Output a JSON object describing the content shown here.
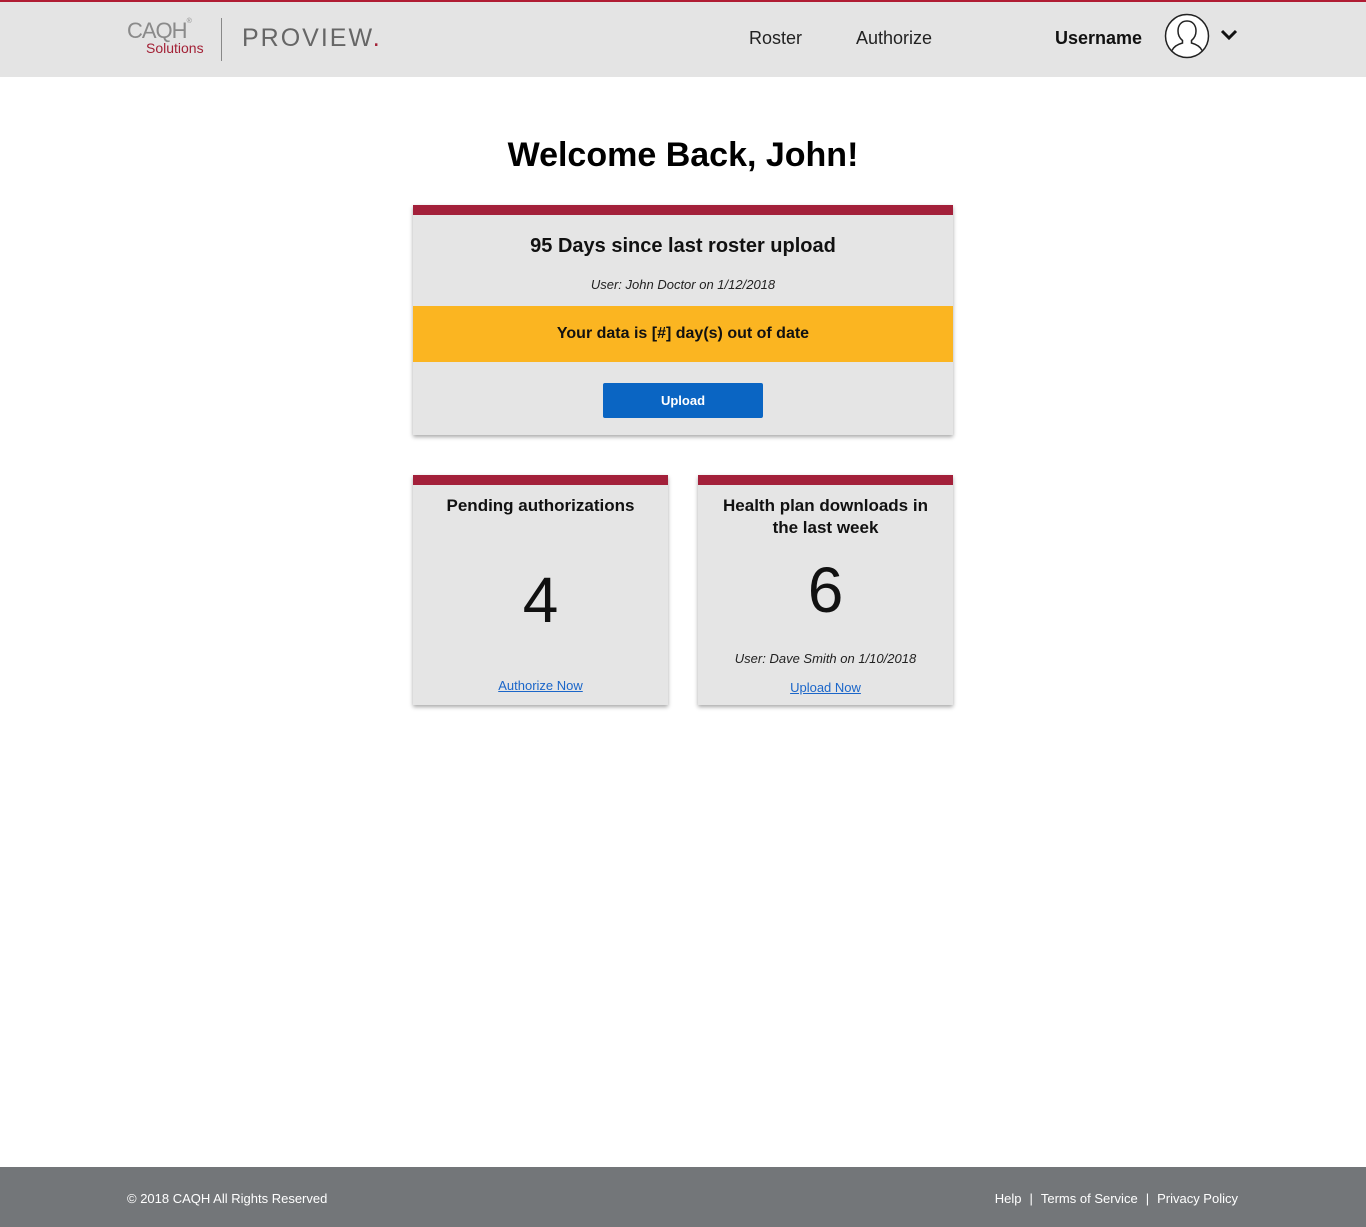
{
  "header": {
    "logo": {
      "brand": "CAQH",
      "brand_mark": "®",
      "sub": "Solutions",
      "product": "PROVIEW",
      "product_dot": "."
    },
    "nav": [
      {
        "label": "Roster"
      },
      {
        "label": "Authorize"
      }
    ],
    "username": "Username",
    "icons": {
      "avatar": "user-avatar-icon",
      "menu": "chevron-down-icon"
    }
  },
  "welcome": "Welcome Back, John!",
  "roster_card": {
    "title": "95 Days since last roster upload",
    "user_line": "User: John Doctor on 1/12/2018",
    "warning": "Your data is [#] day(s) out of date",
    "button": "Upload"
  },
  "pending_card": {
    "title": "Pending authorizations",
    "count": "4",
    "link": "Authorize Now"
  },
  "downloads_card": {
    "title": "Health plan downloads in the last week",
    "count": "6",
    "user_line": "User: Dave Smith on 1/10/2018",
    "link": "Upload Now"
  },
  "footer": {
    "copyright": "© 2018 CAQH All Rights Reserved",
    "links": [
      "Help",
      "Terms of Service",
      "Privacy Policy"
    ],
    "separator": "|"
  },
  "colors": {
    "accent": "#a3203a",
    "warning": "#fbb521",
    "button": "#0a65c3",
    "header_bg": "#e4e4e4",
    "card_bg": "#e5e5e5",
    "footer_bg": "#737679",
    "link": "#1b66c9"
  }
}
